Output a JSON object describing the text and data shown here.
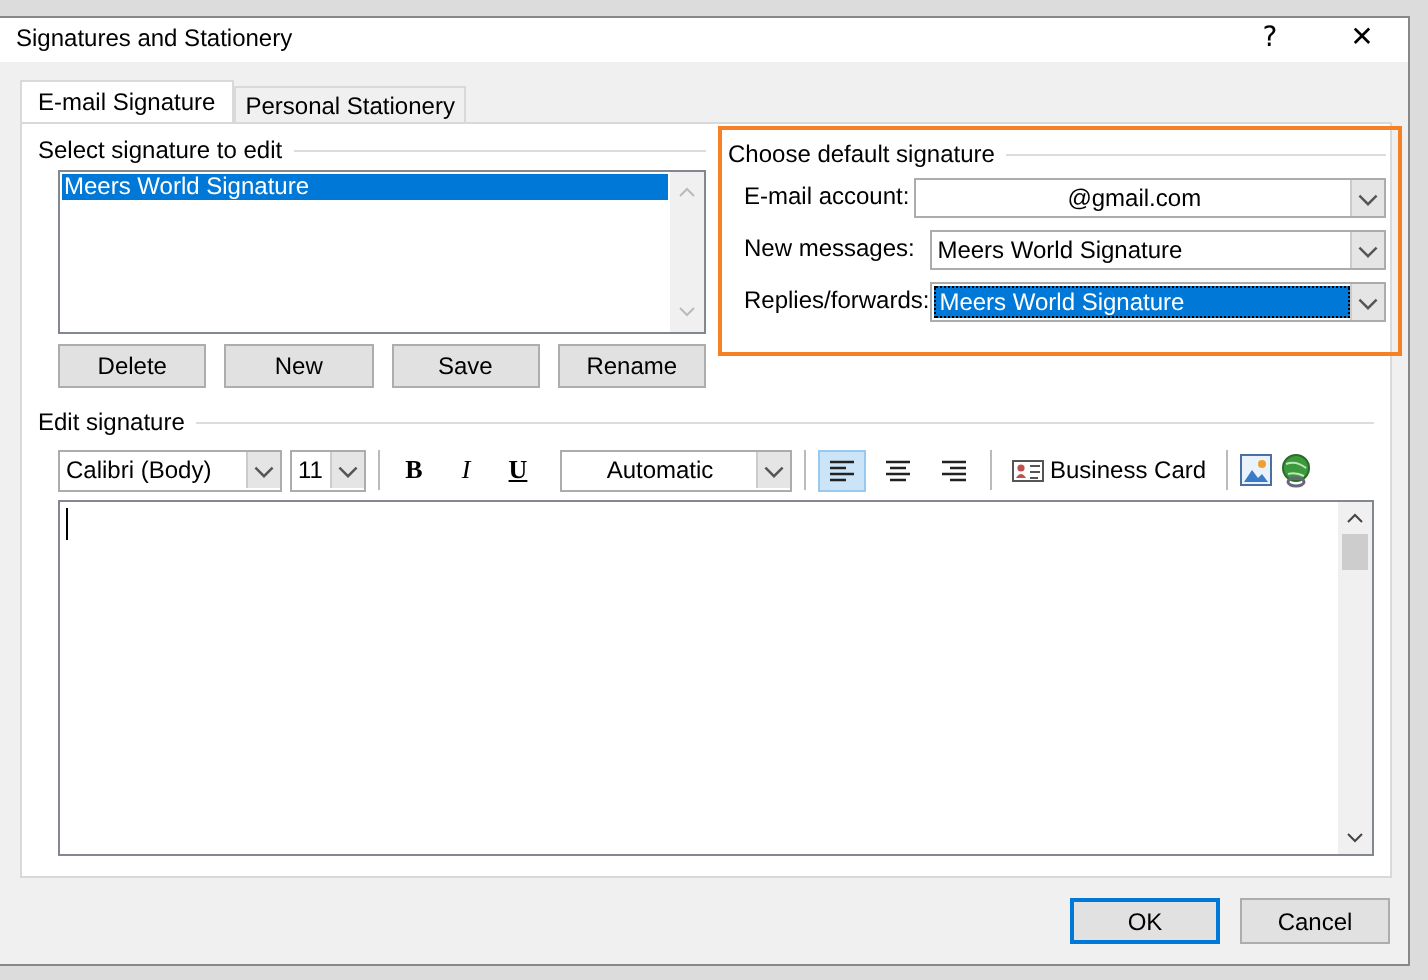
{
  "window": {
    "title": "Signatures and Stationery",
    "help": "?",
    "close": "✕"
  },
  "tabs": [
    {
      "label": "E-mail Signature",
      "selected": true
    },
    {
      "label": "Personal Stationery",
      "selected": false
    }
  ],
  "select_signature": {
    "heading": "Select signature to edit",
    "items": [
      {
        "label": "Meers World Signature",
        "selected": true
      }
    ],
    "buttons": [
      "Delete",
      "New",
      "Save",
      "Rename"
    ]
  },
  "default_signature": {
    "heading": "Choose default signature",
    "fields": [
      {
        "label": "E-mail account:",
        "value": "@gmail.com",
        "highlighted": false
      },
      {
        "label": "New messages:",
        "value": "Meers World Signature",
        "highlighted": false
      },
      {
        "label": "Replies/forwards:",
        "value": "Meers World Signature",
        "highlighted": true
      }
    ]
  },
  "edit_signature": {
    "heading": "Edit signature",
    "toolbar": [
      {
        "kind": "font",
        "value": "Calibri (Body)"
      },
      {
        "kind": "size",
        "value": "11"
      },
      {
        "kind": "sep"
      },
      {
        "kind": "bold",
        "label": "B"
      },
      {
        "kind": "italic",
        "label": "I"
      },
      {
        "kind": "underline",
        "label": "U"
      },
      {
        "kind": "color",
        "value": "Automatic"
      },
      {
        "kind": "sep"
      },
      {
        "kind": "left",
        "selected": true
      },
      {
        "kind": "center",
        "selected": false
      },
      {
        "kind": "right",
        "selected": false
      },
      {
        "kind": "sep"
      },
      {
        "kind": "card-button",
        "label": "Business Card"
      },
      {
        "kind": "sep"
      },
      {
        "kind": "image-button"
      },
      {
        "kind": "link-button"
      }
    ]
  },
  "buttons": [
    {
      "label": "OK",
      "default": true
    },
    {
      "label": "Cancel",
      "default": false
    }
  ]
}
